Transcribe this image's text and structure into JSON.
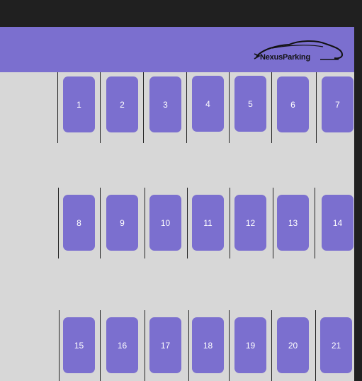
{
  "app": {
    "brand_name": "NexusParking"
  },
  "colors": {
    "accent": "#7b6fcf",
    "lot": "#d7d7d7",
    "chrome": "#202020"
  },
  "spots": [
    "1",
    "2",
    "3",
    "4",
    "5",
    "6",
    "7",
    "8",
    "9",
    "10",
    "11",
    "12",
    "13",
    "14",
    "15",
    "16",
    "17",
    "18",
    "19",
    "20",
    "21"
  ]
}
